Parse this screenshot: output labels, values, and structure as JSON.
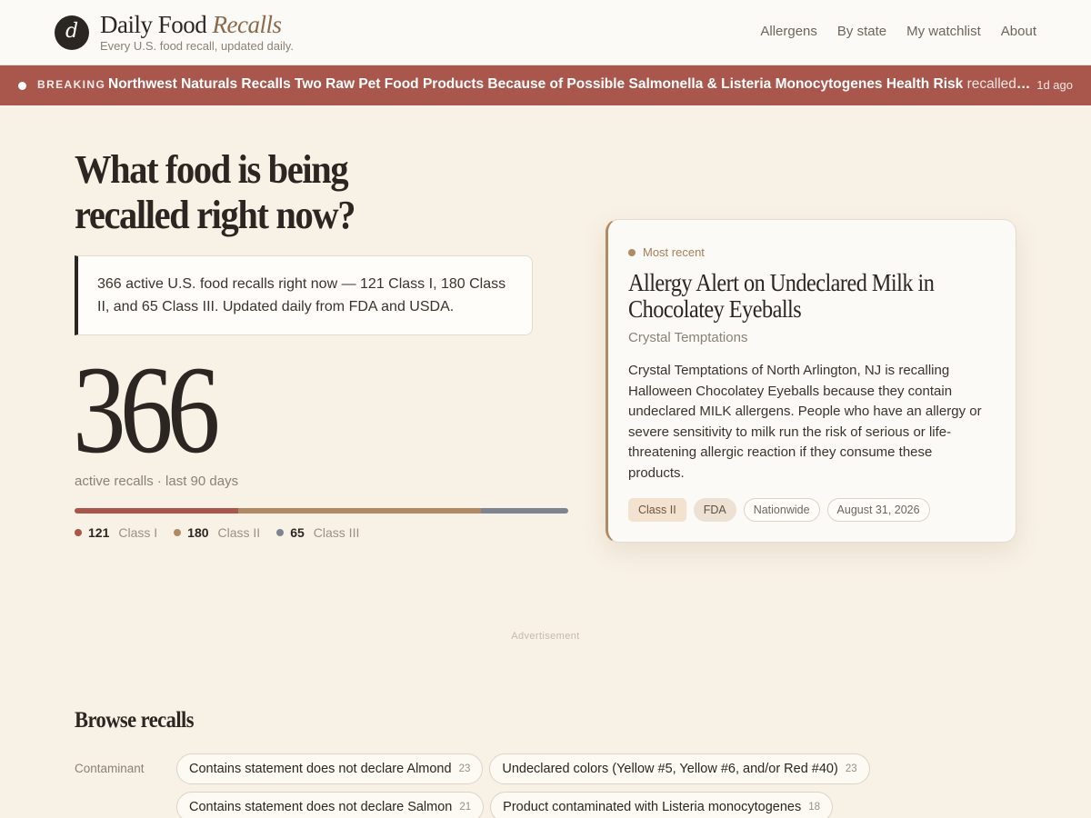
{
  "header": {
    "logo_letter": "d",
    "brand_main": "Daily Food",
    "brand_accent": "Recalls",
    "tagline": "Every U.S. food recall, updated daily.",
    "nav": [
      "Allergens",
      "By state",
      "My watchlist",
      "About"
    ]
  },
  "breaking": {
    "label": "BREAKING",
    "headline": "Northwest Naturals Recalls Two Raw Pet Food Products Because of Possible Salmonella & Listeria Monocytogenes Health Risk",
    "rest": "recalled — Listeria monocytogenes",
    "age": "1d ago"
  },
  "hero": {
    "title": "What food is being recalled right now?",
    "summary": "366 active U.S. food recalls right now — 121 Class I, 180 Class II, and 65 Class III. Updated daily from FDA and USDA.",
    "total": "366",
    "total_sub": "active recalls · last 90 days",
    "classes": [
      {
        "count": "121",
        "label": "Class I",
        "color": "#a9574c",
        "value": 121
      },
      {
        "count": "180",
        "label": "Class II",
        "color": "#b08a62",
        "value": 180
      },
      {
        "count": "65",
        "label": "Class III",
        "color": "#7e8590",
        "value": 65
      }
    ]
  },
  "card": {
    "eyebrow": "Most recent",
    "title": "Allergy Alert on Undeclared Milk in Chocolatey Eyeballs",
    "company": "Crystal Temptations",
    "description": "Crystal Temptations of North Arlington, NJ is recalling Halloween Chocolatey Eyeballs because they contain undeclared MILK allergens. People who have an allergy or severe sensitivity to milk run the risk of serious or life-threatening allergic reaction if they consume these products.",
    "tags": {
      "class": "Class II",
      "agency": "FDA",
      "scope": "Nationwide",
      "date": "August 31, 2026"
    }
  },
  "ad_label": "Advertisement",
  "browse": {
    "title": "Browse recalls",
    "contaminant_label": "Contaminant",
    "chips": [
      {
        "label": "Contains statement does not declare Almond",
        "count": "23"
      },
      {
        "label": "Undeclared colors (Yellow #5, Yellow #6, and/or Red #40)",
        "count": "23"
      },
      {
        "label": "Contains statement does not declare Salmon",
        "count": "21"
      },
      {
        "label": "Product contaminated with Listeria monocytogenes",
        "count": "18"
      }
    ]
  }
}
